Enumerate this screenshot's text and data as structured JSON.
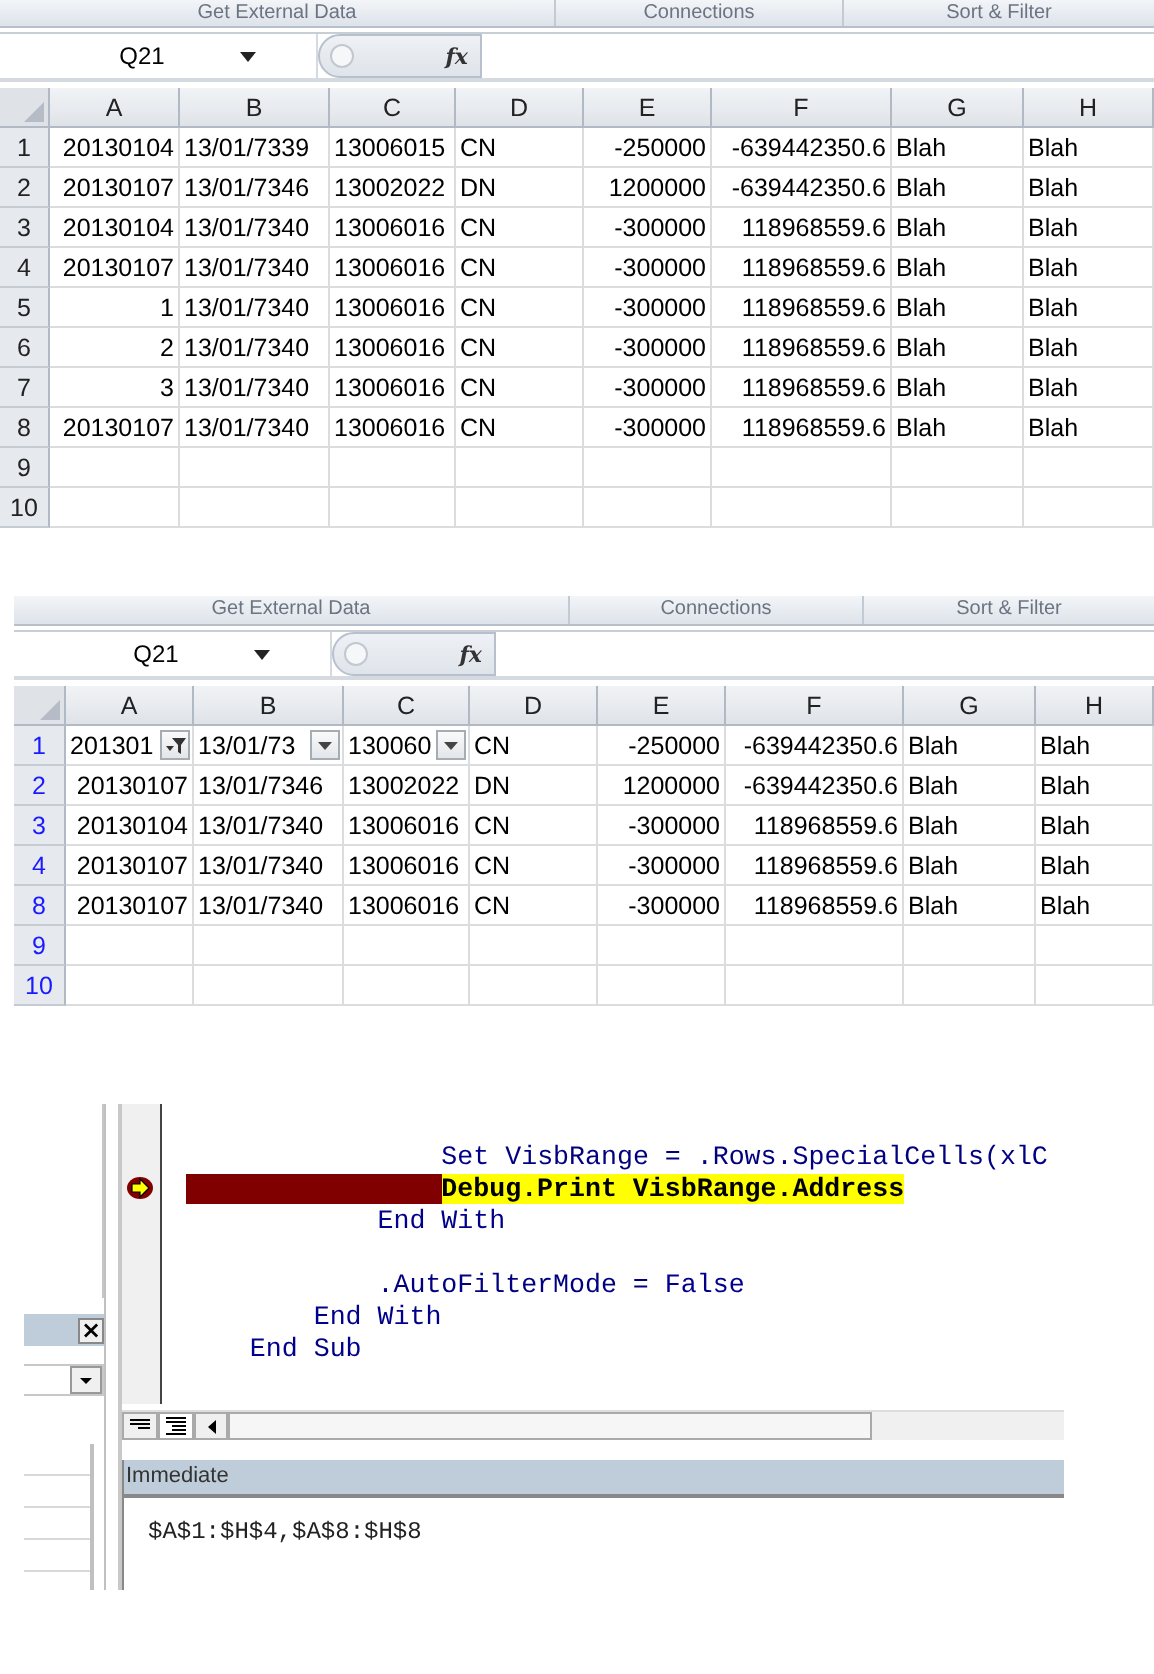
{
  "sheets": [
    {
      "ribbon_groups": [
        "Get External Data",
        "Connections",
        "Sort & Filter"
      ],
      "name_box": "Q21",
      "fx": "fx",
      "filtered": false,
      "columns": [
        "A",
        "B",
        "C",
        "D",
        "E",
        "F",
        "G",
        "H"
      ],
      "rows": [
        {
          "number": "1",
          "cells": [
            "20130104",
            "13/01/7339",
            "13006015",
            "CN",
            "-250000",
            "-639442350.6",
            "Blah",
            "Blah"
          ]
        },
        {
          "number": "2",
          "cells": [
            "20130107",
            "13/01/7346",
            "13002022",
            "DN",
            "1200000",
            "-639442350.6",
            "Blah",
            "Blah"
          ]
        },
        {
          "number": "3",
          "cells": [
            "20130104",
            "13/01/7340",
            "13006016",
            "CN",
            "-300000",
            "118968559.6",
            "Blah",
            "Blah"
          ]
        },
        {
          "number": "4",
          "cells": [
            "20130107",
            "13/01/7340",
            "13006016",
            "CN",
            "-300000",
            "118968559.6",
            "Blah",
            "Blah"
          ]
        },
        {
          "number": "5",
          "cells": [
            "1",
            "13/01/7340",
            "13006016",
            "CN",
            "-300000",
            "118968559.6",
            "Blah",
            "Blah"
          ]
        },
        {
          "number": "6",
          "cells": [
            "2",
            "13/01/7340",
            "13006016",
            "CN",
            "-300000",
            "118968559.6",
            "Blah",
            "Blah"
          ]
        },
        {
          "number": "7",
          "cells": [
            "3",
            "13/01/7340",
            "13006016",
            "CN",
            "-300000",
            "118968559.6",
            "Blah",
            "Blah"
          ]
        },
        {
          "number": "8",
          "cells": [
            "20130107",
            "13/01/7340",
            "13006016",
            "CN",
            "-300000",
            "118968559.6",
            "Blah",
            "Blah"
          ]
        },
        {
          "number": "9"
        },
        {
          "number": "10"
        }
      ]
    },
    {
      "ribbon_groups": [
        "Get External Data",
        "Connections",
        "Sort & Filter"
      ],
      "name_box": "Q21",
      "fx": "fx",
      "filtered": true,
      "columns": [
        "A",
        "B",
        "C",
        "D",
        "E",
        "F",
        "G",
        "H"
      ],
      "filter_buttons": [
        {
          "kind": "active"
        },
        {
          "kind": "dropdown"
        },
        {
          "kind": "dropdown"
        }
      ],
      "rows": [
        {
          "number": "1",
          "cells": [
            "201301",
            "13/01/73",
            "130060",
            "CN",
            "-250000",
            "-639442350.6",
            "Blah",
            "Blah"
          ]
        },
        {
          "number": "2",
          "cells": [
            "20130107",
            "13/01/7346",
            "13002022",
            "DN",
            "1200000",
            "-639442350.6",
            "Blah",
            "Blah"
          ]
        },
        {
          "number": "3",
          "cells": [
            "20130104",
            "13/01/7340",
            "13006016",
            "CN",
            "-300000",
            "118968559.6",
            "Blah",
            "Blah"
          ]
        },
        {
          "number": "4",
          "cells": [
            "20130107",
            "13/01/7340",
            "13006016",
            "CN",
            "-300000",
            "118968559.6",
            "Blah",
            "Blah"
          ]
        },
        {
          "number": "8",
          "cells": [
            "20130107",
            "13/01/7340",
            "13006016",
            "CN",
            "-300000",
            "118968559.6",
            "Blah",
            "Blah"
          ]
        },
        {
          "number": "9"
        },
        {
          "number": "10"
        }
      ]
    }
  ],
  "editor": {
    "code_lines": [
      {
        "current": false,
        "breakpoint": false,
        "tokens": [
          {
            "text": "                Set",
            "kind": "keyword"
          },
          {
            "text": " VisbRange = .Rows.SpecialCells(xlC",
            "kind": "plain"
          }
        ]
      },
      {
        "current": true,
        "breakpoint": true,
        "tokens": [
          {
            "text": "                Debug.Print VisbRange.Address",
            "kind": "plain"
          }
        ]
      },
      {
        "current": false,
        "breakpoint": false,
        "tokens": [
          {
            "text": "            End With",
            "kind": "keyword"
          }
        ]
      },
      {
        "current": false,
        "breakpoint": false
      },
      {
        "current": false,
        "breakpoint": false,
        "tokens": [
          {
            "text": "            .AutoFilterMode = ",
            "kind": "plain"
          },
          {
            "text": "False",
            "kind": "keyword"
          }
        ]
      },
      {
        "current": false,
        "breakpoint": false,
        "tokens": [
          {
            "text": "        End With",
            "kind": "keyword"
          }
        ]
      },
      {
        "current": false,
        "breakpoint": false,
        "tokens": [
          {
            "text": "    End Sub",
            "kind": "keyword"
          }
        ]
      }
    ],
    "close_button": "×",
    "immediate": {
      "title": "Immediate",
      "output": "$A$1:$H$4,$A$8:$H$8"
    }
  }
}
